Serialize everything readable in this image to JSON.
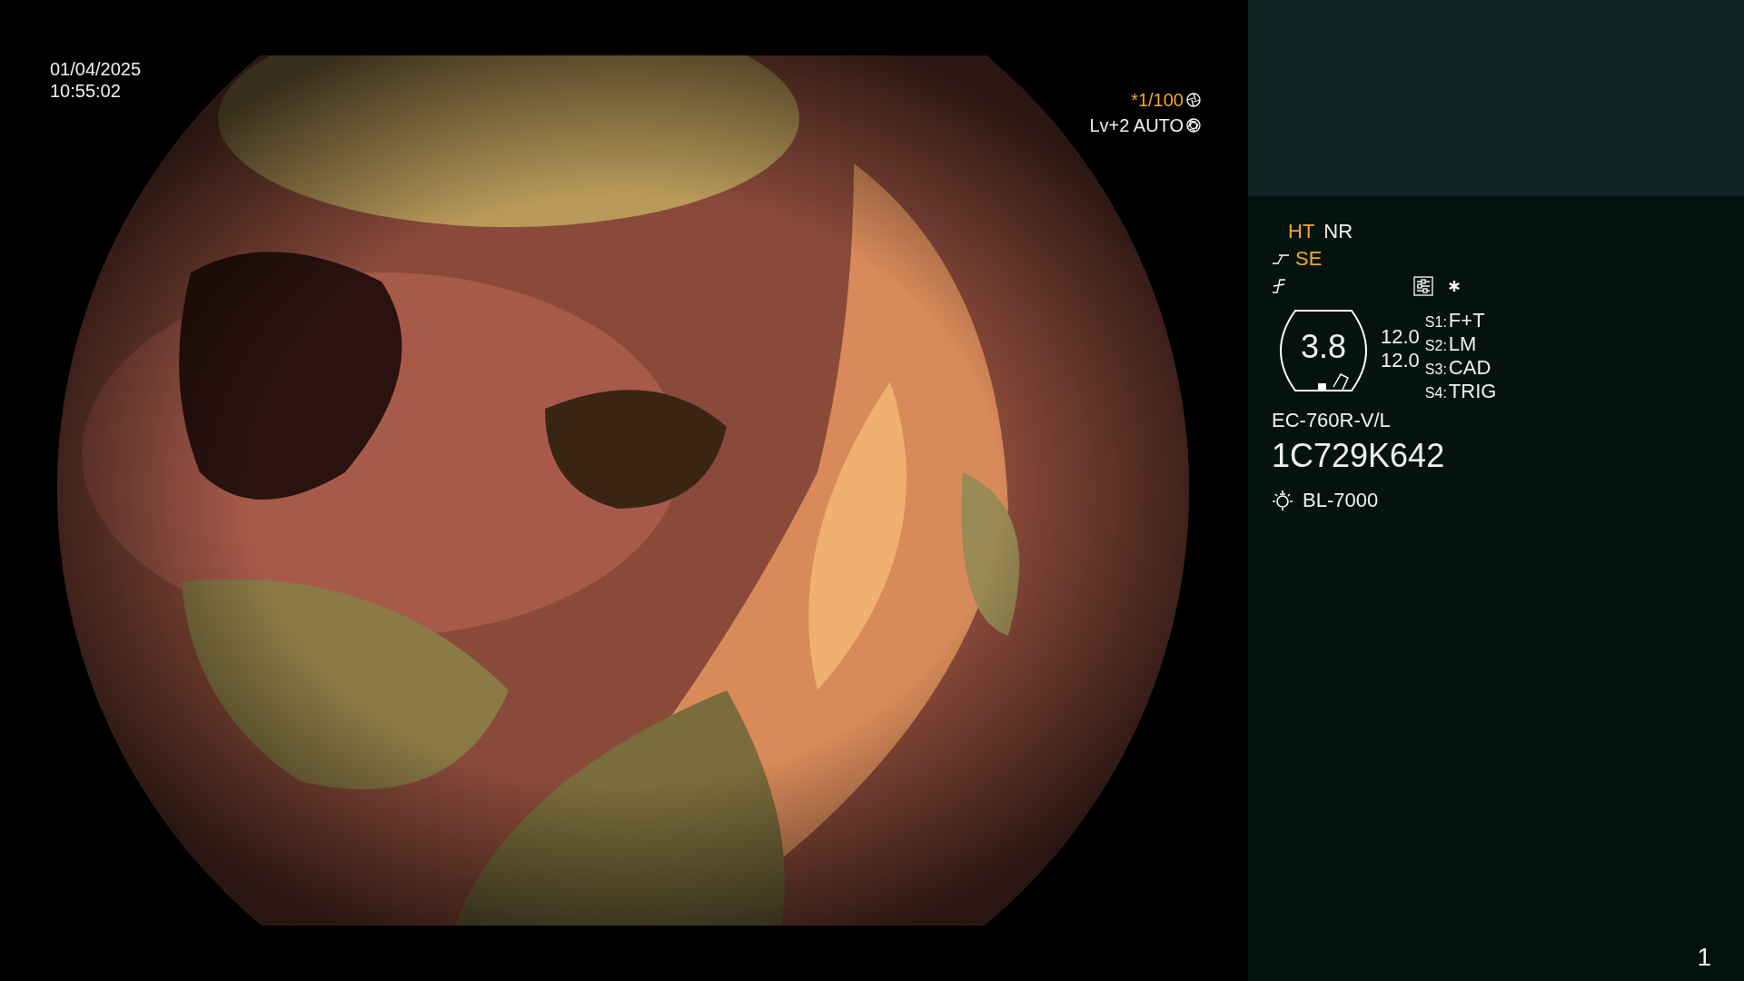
{
  "viewer": {
    "date": "01/04/2025",
    "time": "10:55:02",
    "shutter": {
      "text": "*1/100",
      "active": true
    },
    "exposure": "Lv+2 AUTO"
  },
  "panel": {
    "modes": [
      {
        "label": "HT",
        "active": true
      },
      {
        "label": "NR",
        "active": false
      }
    ],
    "enhance": {
      "label": "SE",
      "active": true
    },
    "zoom": {
      "value": "3.8",
      "readings": [
        "12.0",
        "12.0"
      ]
    },
    "switches": [
      {
        "key": "S1:",
        "value": "F+T"
      },
      {
        "key": "S2:",
        "value": "LM"
      },
      {
        "key": "S3:",
        "value": "CAD"
      },
      {
        "key": "S4:",
        "value": "TRIG"
      }
    ],
    "scope_model": "EC-760R-V/L",
    "scope_serial": "1C729K642",
    "light_source": "BL-7000",
    "page": "1"
  }
}
